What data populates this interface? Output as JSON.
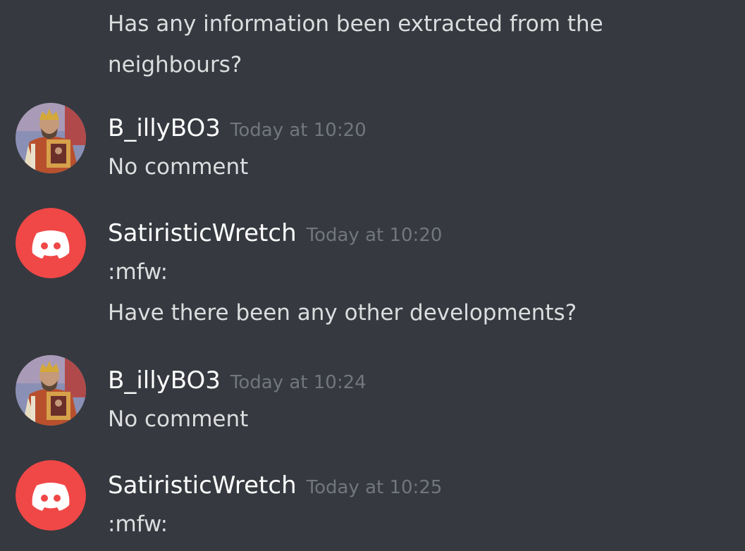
{
  "colors": {
    "background": "#36393f",
    "message_text": "#dcddde",
    "username": "#ffffff",
    "timestamp": "#72767d",
    "discord_avatar": "#f04747"
  },
  "messages": [
    {
      "type": "continuation",
      "lines": [
        "Has any information been extracted from the",
        "neighbours?"
      ]
    },
    {
      "type": "group",
      "author": "B_illyBO3",
      "avatar": "emperor-portrait-avatar",
      "timestamp": "Today at 10:20",
      "lines": [
        "No comment"
      ]
    },
    {
      "type": "group",
      "author": "SatiristicWretch",
      "avatar": "discord-logo-avatar",
      "timestamp": "Today at 10:20",
      "lines": [
        ":mfw:",
        "Have there been any other developments?"
      ]
    },
    {
      "type": "group",
      "author": "B_illyBO3",
      "avatar": "emperor-portrait-avatar",
      "timestamp": "Today at 10:24",
      "lines": [
        "No comment"
      ]
    },
    {
      "type": "group",
      "author": "SatiristicWretch",
      "avatar": "discord-logo-avatar",
      "timestamp": "Today at 10:25",
      "lines": [
        ":mfw:"
      ]
    }
  ]
}
